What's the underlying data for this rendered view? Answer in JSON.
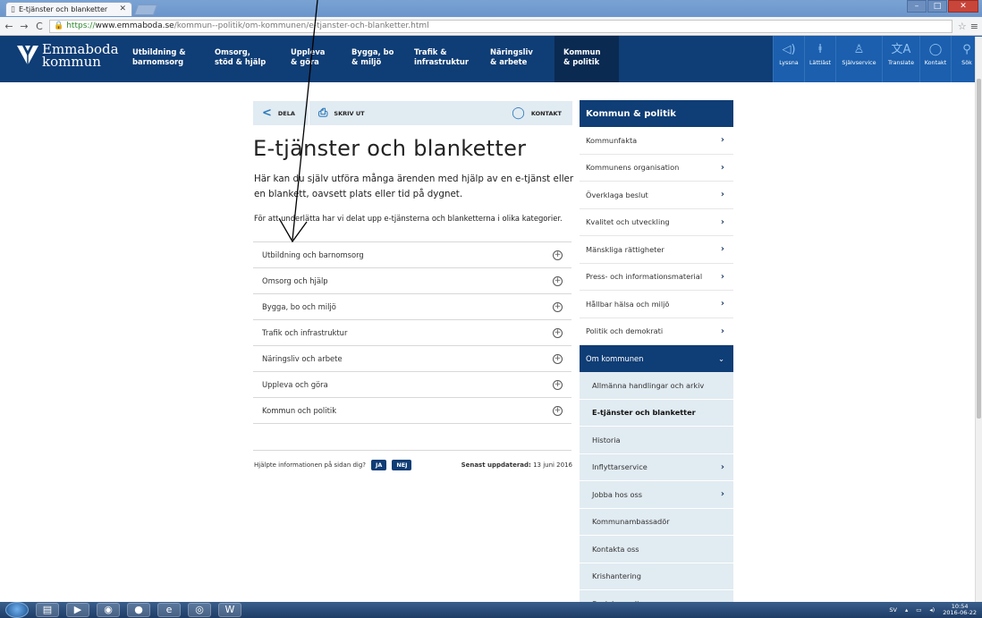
{
  "browser": {
    "tab_title": "E-tjänster och blanketter",
    "url_scheme": "https://",
    "url_domain": "www.emmaboda.se",
    "url_path": "/kommun--politik/om-kommunen/e-tjanster-och-blanketter.html"
  },
  "site": {
    "logo_line1": "Emmaboda",
    "logo_line2": "kommun",
    "nav": [
      {
        "line1": "Utbildning &",
        "line2": "barnomsorg"
      },
      {
        "line1": "Omsorg,",
        "line2": "stöd & hjälp"
      },
      {
        "line1": "Uppleva",
        "line2": "& göra"
      },
      {
        "line1": "Bygga, bo",
        "line2": "& miljö"
      },
      {
        "line1": "Trafik &",
        "line2": "infrastruktur"
      },
      {
        "line1": "Näringsliv",
        "line2": "& arbete"
      },
      {
        "line1": "Kommun",
        "line2": "& politik"
      }
    ],
    "utilities": [
      {
        "label": "Lyssna",
        "icon": "speaker-icon"
      },
      {
        "label": "Lättläst",
        "icon": "easy-read-icon"
      },
      {
        "label": "Självservice",
        "icon": "person-icon"
      },
      {
        "label": "Translate",
        "icon": "translate-icon"
      },
      {
        "label": "Kontakt",
        "icon": "chat-icon"
      },
      {
        "label": "Sök",
        "icon": "search-icon"
      }
    ]
  },
  "share": {
    "share_label": "DELA",
    "print_label": "SKRIV UT",
    "contact_label": "KONTAKT"
  },
  "page": {
    "title": "E-tjänster och blanketter",
    "lead": "Här kan du själv utföra många ärenden med hjälp av en e-tjänst eller en blankett, oavsett plats eller tid på dygnet.",
    "intro": "För att underlätta har vi delat upp e-tjänsterna och blanketterna i olika kategorier.",
    "categories": [
      "Utbildning och barnomsorg",
      "Omsorg och hjälp",
      "Bygga, bo och miljö",
      "Trafik och infrastruktur",
      "Näringsliv och arbete",
      "Uppleva och göra",
      "Kommun och politik"
    ],
    "plus_glyph": "+",
    "feedback_question": "Hjälpte informationen på sidan dig?",
    "yes_label": "JA",
    "no_label": "NEJ",
    "updated_label": "Senast uppdaterad:",
    "updated_date": "13 juni 2016"
  },
  "sidenav": {
    "heading": "Kommun & politik",
    "items": [
      "Kommunfakta",
      "Kommunens organisation",
      "Överklaga beslut",
      "Kvalitet och utveckling",
      "Mänskliga rättigheter",
      "Press- och informationsmaterial",
      "Hållbar hälsa och miljö",
      "Politik och demokrati"
    ],
    "open_section": "Om kommunen",
    "sub_items": [
      {
        "label": "Allmänna handlingar och arkiv",
        "has_children": false
      },
      {
        "label": "E-tjänster och blanketter",
        "has_children": false
      },
      {
        "label": "Historia",
        "has_children": false
      },
      {
        "label": "Inflyttarservice",
        "has_children": true
      },
      {
        "label": "Jobba hos oss",
        "has_children": true
      },
      {
        "label": "Kommunambassadör",
        "has_children": false
      },
      {
        "label": "Kontakta oss",
        "has_children": false
      },
      {
        "label": "Krishantering",
        "has_children": false
      },
      {
        "label": "Sociala medier",
        "has_children": false
      }
    ]
  },
  "taskbar": {
    "lang": "SV",
    "time": "10:54",
    "date": "2016-06-22"
  },
  "colors": {
    "header_navy": "#0f3d75",
    "utility_blue": "#1b5fae",
    "share_bg": "#e1ebf2"
  }
}
